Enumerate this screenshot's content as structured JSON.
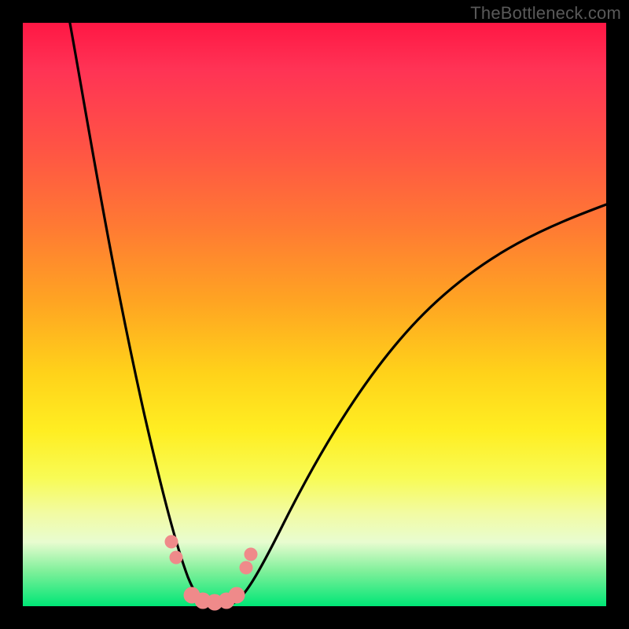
{
  "watermark": "TheBottleneck.com",
  "chart_data": {
    "type": "line",
    "title": "",
    "xlabel": "",
    "ylabel": "",
    "xlim": [
      0,
      100
    ],
    "ylim": [
      0,
      100
    ],
    "grid": false,
    "legend": false,
    "gradient_colors": {
      "top": "#ff1744",
      "upper_mid": "#ff8a33",
      "mid": "#ffd21a",
      "lower_mid": "#f8fb55",
      "bottom": "#00e676"
    },
    "series": [
      {
        "name": "left-branch",
        "color": "#000000",
        "x": [
          8,
          10,
          12,
          14,
          16,
          18,
          20,
          22,
          24,
          26,
          28,
          30
        ],
        "y": [
          100,
          92,
          84,
          75,
          66,
          56,
          46,
          35,
          24,
          13,
          4,
          0
        ]
      },
      {
        "name": "right-branch",
        "color": "#000000",
        "x": [
          36,
          40,
          45,
          50,
          55,
          60,
          65,
          70,
          75,
          80,
          85,
          90,
          95,
          100
        ],
        "y": [
          0,
          6,
          14,
          22,
          30,
          37,
          43,
          48,
          53,
          57,
          61,
          64,
          67,
          69
        ]
      },
      {
        "name": "bottom-flat",
        "color": "#000000",
        "x": [
          30,
          32,
          34,
          36
        ],
        "y": [
          0,
          0,
          0,
          0
        ]
      }
    ],
    "markers": {
      "name": "salmon-dots",
      "color": "#f08080",
      "radius_large": 11,
      "radius_small": 9,
      "points": [
        {
          "x": 25.5,
          "y": 11,
          "r": "small"
        },
        {
          "x": 26.3,
          "y": 8,
          "r": "small"
        },
        {
          "x": 29.0,
          "y": 1.5,
          "r": "large"
        },
        {
          "x": 30.8,
          "y": 0.7,
          "r": "large"
        },
        {
          "x": 32.8,
          "y": 0.5,
          "r": "large"
        },
        {
          "x": 34.8,
          "y": 0.7,
          "r": "large"
        },
        {
          "x": 36.5,
          "y": 1.6,
          "r": "large"
        },
        {
          "x": 38.2,
          "y": 6.5,
          "r": "small"
        },
        {
          "x": 39.0,
          "y": 8.8,
          "r": "small"
        }
      ]
    }
  }
}
